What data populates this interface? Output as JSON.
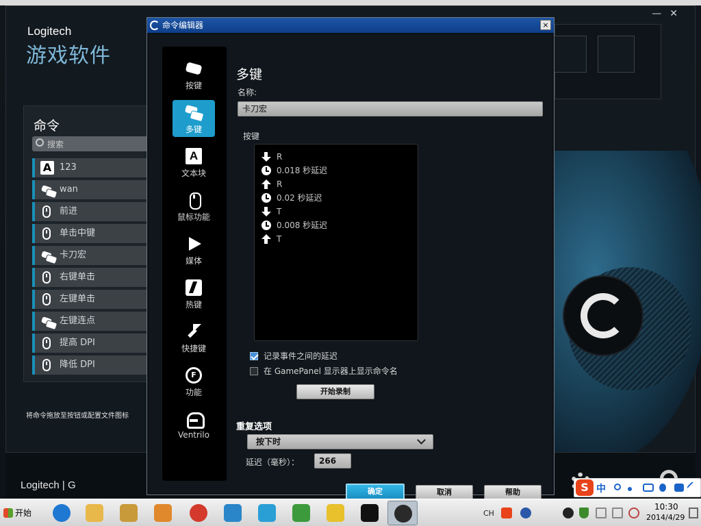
{
  "background_app": {
    "brand": "Logitech",
    "brand_sub": "游戏软件",
    "commands_panel": {
      "title": "命令",
      "search_placeholder": "搜索",
      "items": [
        {
          "label": "123",
          "icon": "text-block-icon"
        },
        {
          "label": "wan",
          "icon": "multi-key-icon"
        },
        {
          "label": "前进",
          "icon": "mouse-icon"
        },
        {
          "label": "单击中键",
          "icon": "mouse-icon"
        },
        {
          "label": "卡刀宏",
          "icon": "multi-key-icon"
        },
        {
          "label": "右键单击",
          "icon": "mouse-icon"
        },
        {
          "label": "左键单击",
          "icon": "mouse-icon"
        },
        {
          "label": "左键连点",
          "icon": "multi-key-icon"
        },
        {
          "label": "提高 DPI",
          "icon": "mouse-icon"
        },
        {
          "label": "降低 DPI",
          "icon": "mouse-icon"
        }
      ],
      "hint": "将命令拖放至按钮或配置文件图标"
    },
    "bottom_logo": "Logitech | G"
  },
  "dialog": {
    "title": "命令编辑器",
    "close_label": "×",
    "nav": [
      {
        "label": "按键",
        "icon": "key-icon",
        "active": false
      },
      {
        "label": "多键",
        "icon": "multi-key-icon",
        "active": true
      },
      {
        "label": "文本块",
        "icon": "text-block-icon",
        "active": false
      },
      {
        "label": "鼠标功能",
        "icon": "mouse-icon",
        "active": false
      },
      {
        "label": "媒体",
        "icon": "play-icon",
        "active": false
      },
      {
        "label": "热键",
        "icon": "hotkey-icon",
        "active": false
      },
      {
        "label": "快捷键",
        "icon": "shortcut-arrow-icon",
        "active": false
      },
      {
        "label": "功能",
        "icon": "function-icon",
        "active": false
      },
      {
        "label": "Ventrilo",
        "icon": "headset-icon",
        "active": false
      }
    ],
    "section_title": "多键",
    "name_label": "名称:",
    "name_value": "卡刀宏",
    "keys_label": "按键",
    "events": [
      {
        "type": "down",
        "text": "R"
      },
      {
        "type": "delay",
        "text": "0.018 秒延迟"
      },
      {
        "type": "up",
        "text": "R"
      },
      {
        "type": "delay",
        "text": "0.02 秒延迟"
      },
      {
        "type": "down",
        "text": "T"
      },
      {
        "type": "delay",
        "text": "0.008 秒延迟"
      },
      {
        "type": "up",
        "text": "T"
      }
    ],
    "checkbox_delay": {
      "label": "记录事件之间的延迟",
      "checked": true
    },
    "checkbox_gamepanel": {
      "label": "在 GamePanel 显示器上显示命令名",
      "checked": false
    },
    "record_button": "开始录制",
    "repeat_label": "重复选项",
    "repeat_value": "按下时",
    "delay_label": "延迟（毫秒）：",
    "delay_value": "266",
    "ok_button": "确定",
    "cancel_button": "取消",
    "help_button": "帮助"
  },
  "ime": {
    "mode": "中"
  },
  "taskbar": {
    "start_label": "开始",
    "apps": [
      "ie-icon",
      "folder-icon",
      "explorer-icon",
      "media-icon",
      "chrome-icon",
      "bird-icon",
      "network-icon",
      "green-app-icon",
      "star-icon",
      "qq-icon",
      "logitech-g-icon"
    ],
    "lang": "CH",
    "time": "10:30",
    "date": "2014/4/29"
  },
  "colors": {
    "accent": "#1e9dcc",
    "dialog_title": "#1d55a5",
    "background": "#10161b"
  }
}
